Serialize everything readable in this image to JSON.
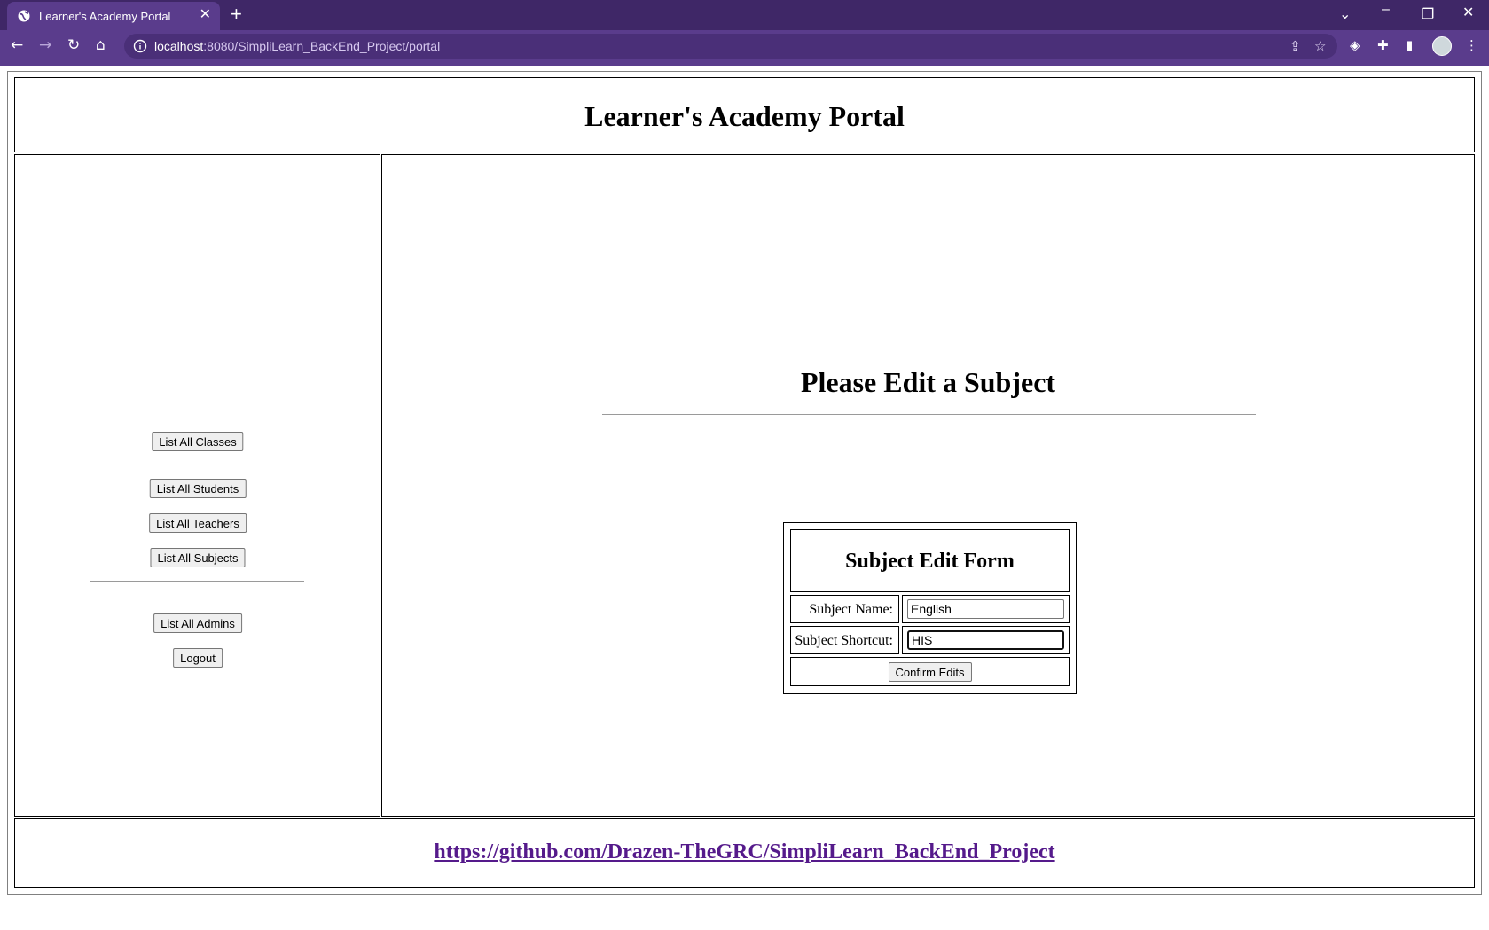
{
  "browser": {
    "tab_title": "Learner's Academy Portal",
    "tab_close_glyph": "✕",
    "new_tab_glyph": "+",
    "url_host": "localhost",
    "url_path": ":8080/SimpliLearn_BackEnd_Project/portal",
    "icons": [
      "back-arrow-icon",
      "forward-arrow-icon",
      "reload-icon",
      "home-icon",
      "site-info-icon",
      "share-icon",
      "bookmark-star-icon",
      "extension-icon",
      "puzzle-icon",
      "side-panel-icon",
      "profile-avatar-icon",
      "menu-kebab-icon",
      "tab-list-chevron-icon",
      "minimize-icon",
      "restore-icon",
      "close-window-icon"
    ]
  },
  "header": {
    "title": "Learner's Academy Portal"
  },
  "sidebar": {
    "buttons": [
      {
        "label": "List All Classes"
      },
      {
        "label": "List All Students"
      },
      {
        "label": "List All Teachers"
      },
      {
        "label": "List All Subjects"
      },
      {
        "label": "List All Admins"
      },
      {
        "label": "Logout"
      }
    ]
  },
  "main": {
    "heading": "Please Edit a Subject",
    "form": {
      "title": "Subject Edit Form",
      "name_label": "Subject Name:",
      "name_value": "English",
      "shortcut_label": "Subject Shortcut:",
      "shortcut_value": "HIS",
      "submit_label": "Confirm Edits"
    }
  },
  "footer": {
    "link_text": "https://github.com/Drazen-TheGRC/SimpliLearn_BackEnd_Project"
  },
  "colors": {
    "chrome_dark": "#3f2767",
    "chrome": "#5a3c8c",
    "visited_link": "#551a8b"
  }
}
